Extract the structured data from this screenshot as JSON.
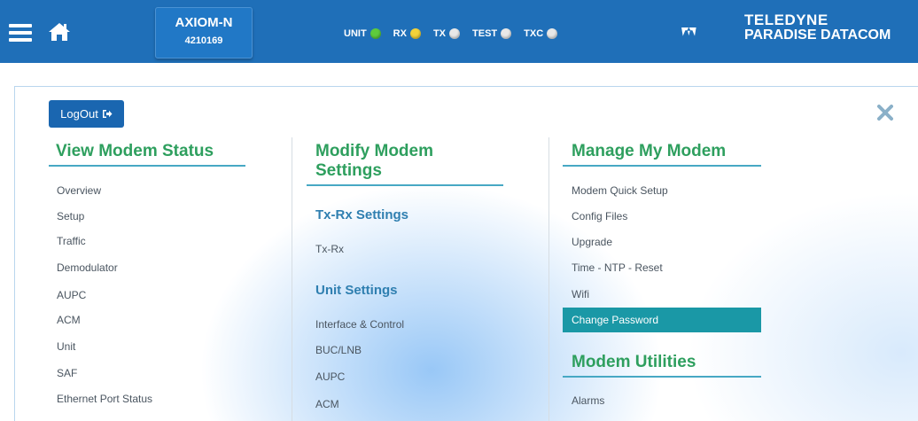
{
  "header": {
    "model": "AXIOM-N",
    "serial": "4210169",
    "indicators": [
      {
        "label": "UNIT",
        "color": "#5ecb3c"
      },
      {
        "label": "RX",
        "color": "#f2d23a"
      },
      {
        "label": "TX",
        "color": "#e8e8e8"
      },
      {
        "label": "TEST",
        "color": "#e8e8e8"
      },
      {
        "label": "TXC",
        "color": "#e8e8e8"
      }
    ],
    "logo_line1": "TELEDYNE",
    "logo_line2": "PARADISE DATACOM"
  },
  "menu": {
    "logout_label": "LogOut",
    "col1": {
      "title": "View Modem Status",
      "items": [
        "Overview",
        "Setup",
        "Traffic",
        "Demodulator",
        "AUPC",
        "ACM",
        "Unit",
        "SAF",
        "Ethernet Port Status"
      ]
    },
    "col2": {
      "title_line1": "Modify Modem",
      "title_line2": "Settings",
      "section1": "Tx-Rx Settings",
      "section1_items": [
        "Tx-Rx"
      ],
      "section2": "Unit Settings",
      "section2_items": [
        "Interface & Control",
        "BUC/LNB",
        "AUPC",
        "ACM"
      ]
    },
    "col3": {
      "title": "Manage My Modem",
      "items": [
        "Modem Quick Setup",
        "Config Files",
        "Upgrade",
        "Time - NTP - Reset",
        "Wifi",
        "Change Password"
      ],
      "section2": "Modem Utilities",
      "section2_items": [
        "Alarms"
      ]
    }
  },
  "colors": {
    "header_bg": "#1f6fb8",
    "title_green": "#2e9f5e",
    "subtitle_blue": "#2f7fb0",
    "highlight": "#1a98a6"
  }
}
